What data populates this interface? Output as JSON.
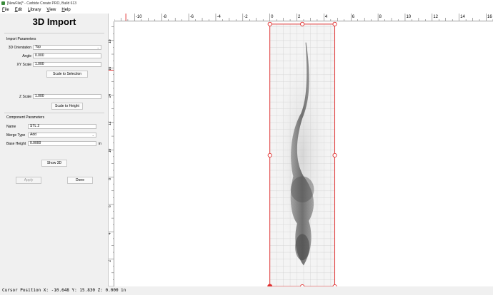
{
  "window": {
    "title": "[NewFile]* - Carbide Create PRO, Build 613"
  },
  "menu": [
    {
      "label": "File",
      "key": "F"
    },
    {
      "label": "Edit",
      "key": "E"
    },
    {
      "label": "Library",
      "key": "L"
    },
    {
      "label": "View",
      "key": "V"
    },
    {
      "label": "Help",
      "key": "H"
    }
  ],
  "panel": {
    "title": "3D Import",
    "import_section": "Import Parameters",
    "orientation_label": "3D Orientation",
    "orientation_value": "Top",
    "angle_label": "Angle",
    "angle_value": "0.000",
    "xy_scale_label": "XY Scale",
    "xy_scale_value": "1.000",
    "scale_selection_btn": "Scale to Selection",
    "z_scale_label": "Z Scale",
    "z_scale_value": "1.000",
    "scale_height_btn": "Scale to Height",
    "component_section": "Component Parameters",
    "name_label": "Name",
    "name_value": "STL 2",
    "merge_label": "Merge Type",
    "merge_value": "Add",
    "base_height_label": "Base Height",
    "base_height_value": "0.0000",
    "base_height_unit": "in",
    "show3d_btn": "Show 3D",
    "apply_btn": "Apply",
    "done_btn": "Done"
  },
  "ruler": {
    "x_ticks": [
      "-10",
      "-8",
      "-6",
      "-4",
      "-2",
      "0",
      "2",
      "4",
      "6",
      "8",
      "10",
      "12",
      "14",
      "16"
    ],
    "y_ticks": [
      "18",
      "16",
      "14",
      "12",
      "10",
      "8",
      "6",
      "4",
      "2",
      "0"
    ],
    "x_range": [
      -11.5,
      16.5
    ],
    "y_range": [
      0,
      19.4
    ],
    "cursor_x": -10.648,
    "cursor_y": 15.83
  },
  "model": {
    "x0": 0,
    "x1": 4.8,
    "y0": 0,
    "y1": 19.2
  },
  "colors": {
    "selection": "#e03030",
    "grid": "#cfcfcf",
    "ruler_cursor": "#e03030"
  },
  "status": {
    "text": "Cursor Position X: -10.648 Y: 15.830 Z: 0.000 in"
  }
}
